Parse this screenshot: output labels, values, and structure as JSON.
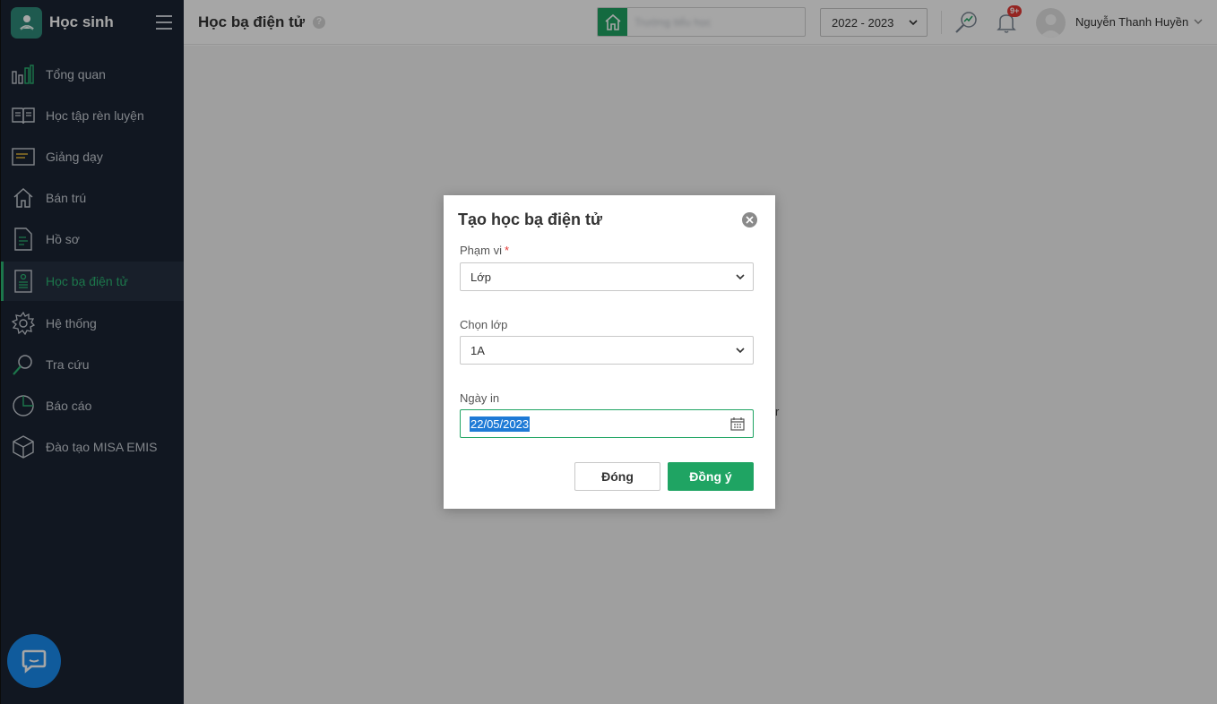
{
  "app": {
    "title": "Học sinh"
  },
  "sidebar": {
    "items": [
      {
        "label": "Tổng quan",
        "icon": "bar-chart-icon"
      },
      {
        "label": "Học tập rèn luyện",
        "icon": "book-icon"
      },
      {
        "label": "Giảng dạy",
        "icon": "board-icon"
      },
      {
        "label": "Bán trú",
        "icon": "home-icon"
      },
      {
        "label": "Hồ sơ",
        "icon": "document-icon"
      },
      {
        "label": "Học bạ điện tử",
        "icon": "certificate-icon",
        "active": true
      },
      {
        "label": "Hệ thống",
        "icon": "gear-icon"
      },
      {
        "label": "Tra cứu",
        "icon": "search-icon"
      },
      {
        "label": "Báo cáo",
        "icon": "pie-chart-icon"
      },
      {
        "label": "Đào tạo MISA EMIS",
        "icon": "cube-icon"
      }
    ]
  },
  "header": {
    "title": "Học bạ điện tử",
    "help": "?",
    "school_name": "Trường tiểu học",
    "year": "2022 - 2023",
    "notification_badge": "9+",
    "user_name": "Nguyễn Thanh Huyền"
  },
  "content": {
    "partial_text": "r"
  },
  "modal": {
    "title": "Tạo học bạ điện tử",
    "scope_label": "Phạm vi",
    "required_mark": "*",
    "scope_value": "Lớp",
    "class_label": "Chọn lớp",
    "class_value": "1A",
    "date_label": "Ngày in",
    "date_value": "22/05/2023",
    "cancel_label": "Đóng",
    "ok_label": "Đồng ý"
  },
  "colors": {
    "sidebar_bg": "#1b2433",
    "accent_green": "#1fa463",
    "active_text": "#2bb673",
    "chat_blue": "#1a8cf0",
    "badge_red": "#e53935"
  }
}
